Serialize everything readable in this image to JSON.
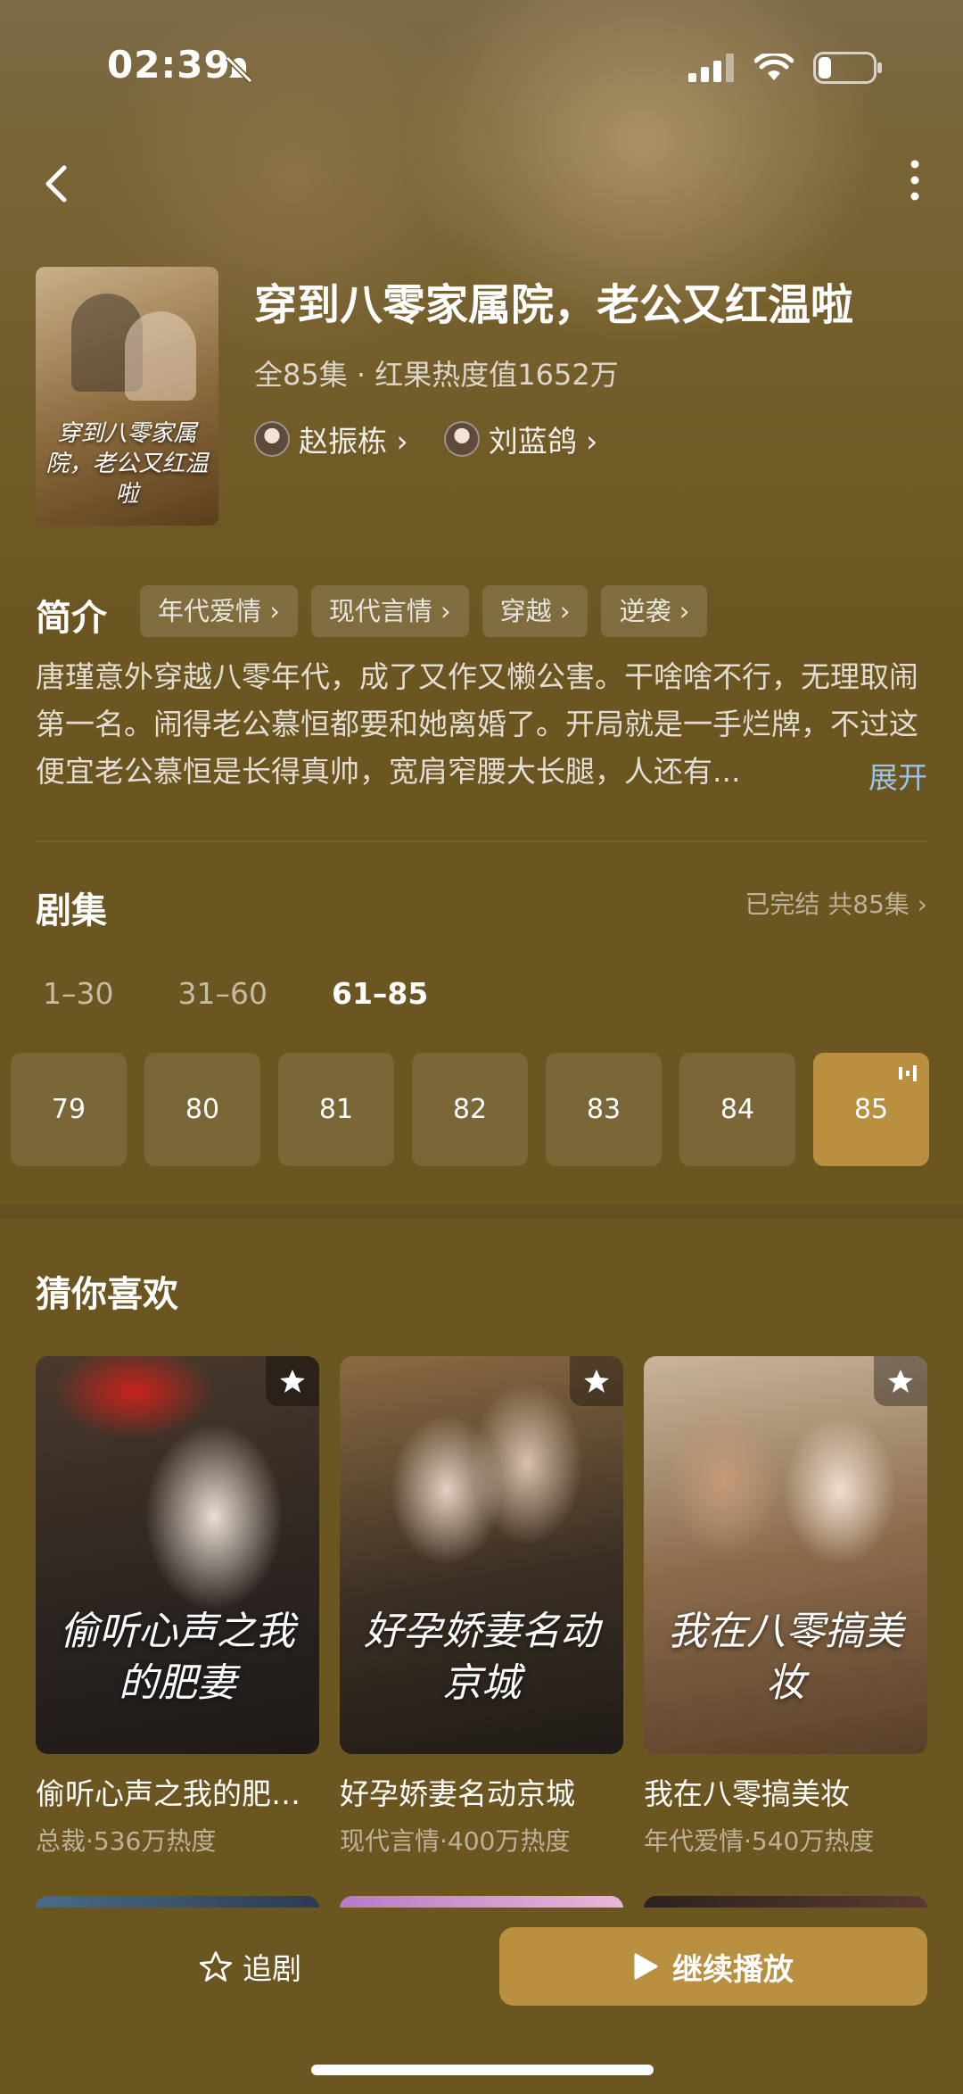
{
  "status_bar": {
    "time": "02:39"
  },
  "show": {
    "title": "穿到八零家属院，老公又红温啦",
    "poster_text": "穿到八零家属院，老公又红温啦",
    "meta": "全85集 · 红果热度值1652万",
    "actors": [
      {
        "name": "赵振栋 ›"
      },
      {
        "name": "刘蓝鸽 ›"
      }
    ]
  },
  "intro": {
    "title": "简介",
    "tags": [
      "年代爱情 ›",
      "现代言情 ›",
      "穿越 ›",
      "逆袭 ›"
    ],
    "synopsis": "唐瑾意外穿越八零年代，成了又作又懒公害。干啥啥不行，无理取闹第一名。闹得老公慕恒都要和她离婚了。开局就是一手烂牌，不过这便宜老公慕恒是长得真帅，宽肩窄腰大长腿，人还有...",
    "expand_label": "展开"
  },
  "episodes": {
    "title": "剧集",
    "status": "已完结 共85集 ›",
    "ranges": [
      "1–30",
      "31–60",
      "61–85"
    ],
    "active_range": 2,
    "items": [
      "79",
      "80",
      "81",
      "82",
      "83",
      "84",
      "85"
    ],
    "active_episode": "85"
  },
  "recommend": {
    "title": "猜你喜欢",
    "items": [
      {
        "name": "偷听心声之我的肥…",
        "sub": "总裁·536万热度",
        "cover_text": "偷听心声之我的肥妻"
      },
      {
        "name": "好孕娇妻名动京城",
        "sub": "现代言情·400万热度",
        "cover_text": "好孕娇妻名动京城"
      },
      {
        "name": "我在八零搞美妆",
        "sub": "年代爱情·540万热度",
        "cover_text": "我在八零搞美妆"
      }
    ]
  },
  "actions": {
    "follow_label": "追剧",
    "play_label": "继续播放"
  },
  "colors": {
    "background": "#6b5520",
    "accent": "#b8903f",
    "link": "#9cc4e6"
  }
}
